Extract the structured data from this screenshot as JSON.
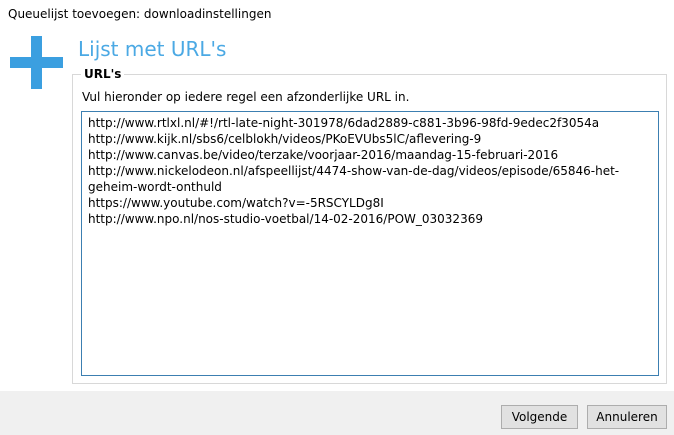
{
  "window": {
    "title": "Queuelijst toevoegen: downloadinstellingen"
  },
  "header": {
    "icon": "plus-icon",
    "heading": "Lijst met URL's",
    "accent_color": "#3b9fe0"
  },
  "url_group": {
    "legend": "URL's",
    "instruction": "Vul hieronder op iedere regel een afzonderlijke URL in.",
    "urls_value": "http://www.rtlxl.nl/#!/rtl-late-night-301978/6dad2889-c881-3b96-98fd-9edec2f3054a\nhttp://www.kijk.nl/sbs6/celblokh/videos/PKoEVUbs5lC/aflevering-9\nhttp://www.canvas.be/video/terzake/voorjaar-2016/maandag-15-februari-2016\nhttp://www.nickelodeon.nl/afspeellijst/4474-show-van-de-dag/videos/episode/65846-het-geheim-wordt-onthuld\nhttps://www.youtube.com/watch?v=-5RSCYLDg8I\nhttp://www.npo.nl/nos-studio-voetbal/14-02-2016/POW_03032369"
  },
  "footer": {
    "next_label": "Volgende",
    "cancel_label": "Annuleren"
  }
}
